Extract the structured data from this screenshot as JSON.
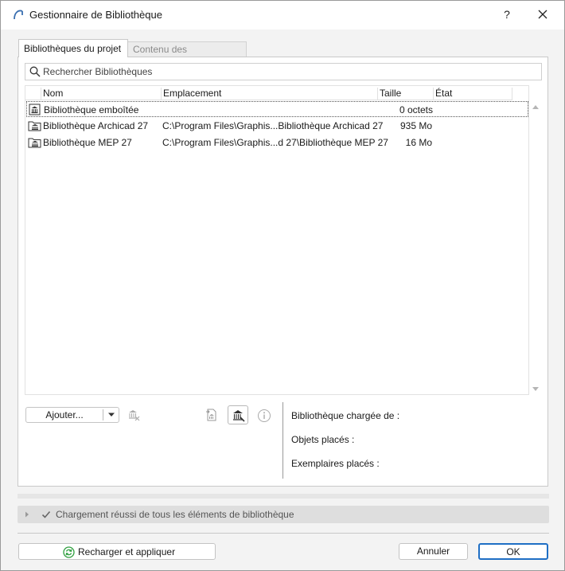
{
  "window": {
    "title": "Gestionnaire de Bibliothèque",
    "help_label": "?"
  },
  "tabs": [
    {
      "label": "Bibliothèques du projet",
      "active": true
    },
    {
      "label": "Contenu des bibliothèques",
      "active": false
    }
  ],
  "search": {
    "placeholder": "Rechercher Bibliothèques",
    "value": ""
  },
  "table": {
    "columns": [
      "Nom",
      "Emplacement",
      "Taille",
      "État"
    ],
    "rows": [
      {
        "name": "Bibliothèque emboîtée",
        "location": "",
        "size": "0 octets",
        "state": "",
        "icon": "library-embedded-icon",
        "selected": true
      },
      {
        "name": "Bibliothèque Archicad 27",
        "location": "C:\\Program Files\\Graphis...Bibliothèque Archicad 27",
        "size": "935 Mo",
        "state": "",
        "icon": "library-folder-icon",
        "selected": false
      },
      {
        "name": "Bibliothèque MEP 27",
        "location": "C:\\Program Files\\Graphis...d 27\\Bibliothèque MEP 27",
        "size": "16 Mo",
        "state": "",
        "icon": "library-folder-icon",
        "selected": false
      }
    ]
  },
  "toolbar": {
    "add_label": "Ajouter..."
  },
  "info": {
    "loaded_from": "Bibliothèque chargée de :",
    "placed_objects": "Objets placés :",
    "placed_instances": "Exemplaires placés :"
  },
  "status": {
    "text": "Chargement réussi de tous les éléments de bibliothèque"
  },
  "footer": {
    "reload_label": "Recharger et appliquer",
    "cancel_label": "Annuler",
    "ok_label": "OK"
  },
  "colors": {
    "accent": "#1f6fc5",
    "reload_green": "#2e9e3e",
    "status_bg": "#dedede"
  }
}
